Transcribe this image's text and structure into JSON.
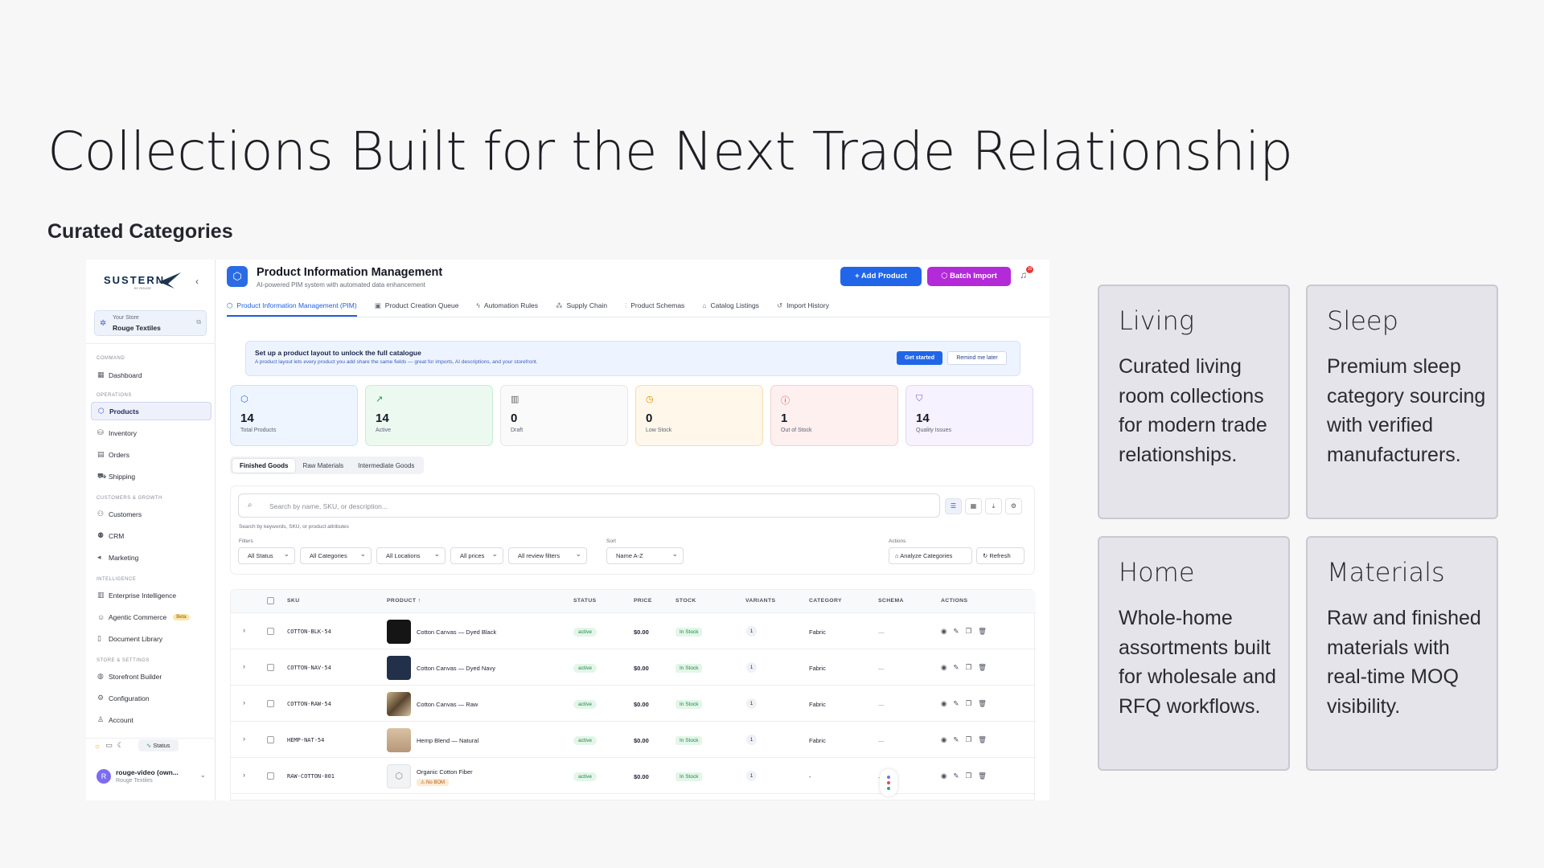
{
  "slide": {
    "title": "Collections Built for the Next Trade Relationship",
    "subtitle": "Curated Categories"
  },
  "sidebar": {
    "logo": "SUSTERN",
    "logo_tagline": "BY ROUGE",
    "store_label": "Your Store",
    "store_name": "Rouge Textiles",
    "sections": {
      "command": "COMMAND",
      "operations": "OPERATIONS",
      "customers": "CUSTOMERS & GROWTH",
      "intelligence": "INTELLIGENCE",
      "store": "STORE & SETTINGS"
    },
    "items": {
      "dashboard": "Dashboard",
      "products": "Products",
      "inventory": "Inventory",
      "orders": "Orders",
      "shipping": "Shipping",
      "customers": "Customers",
      "crm": "CRM",
      "marketing": "Marketing",
      "enterprise": "Enterprise Intelligence",
      "agentic": "Agentic Commerce",
      "agentic_badge": "Beta",
      "library": "Document Library",
      "storefront": "Storefront Builder",
      "configuration": "Configuration",
      "account": "Account"
    },
    "status_label": "Status",
    "user_name": "rouge-video (own...",
    "user_org": "Rouge Textiles",
    "user_initial": "R"
  },
  "header": {
    "title": "Product Information Management",
    "subtitle": "AI-powered PIM system with automated data enhancement",
    "add_label": "+ Add Product",
    "batch_label": "Batch Import",
    "notif_count": "10"
  },
  "tabs": [
    "Product Information Management (PIM)",
    "Product Creation Queue",
    "Automation Rules",
    "Supply Chain",
    "Product Schemas",
    "Catalog Listings",
    "Import History"
  ],
  "banner": {
    "title": "Set up a product layout to unlock the full catalogue",
    "body": "A product layout lets every product you add share the same fields — great for imports, AI descriptions, and your storefront.",
    "primary": "Get started",
    "secondary": "Remind me later"
  },
  "stats": [
    {
      "value": "14",
      "label": "Total Products"
    },
    {
      "value": "14",
      "label": "Active"
    },
    {
      "value": "0",
      "label": "Draft"
    },
    {
      "value": "0",
      "label": "Low Stock"
    },
    {
      "value": "1",
      "label": "Out of Stock"
    },
    {
      "value": "14",
      "label": "Quality Issues"
    }
  ],
  "segments": [
    "Finished Goods",
    "Raw Materials",
    "Intermediate Goods"
  ],
  "filters": {
    "search_placeholder": "Search by name, SKU, or description...",
    "hint": "Search by keywords, SKU, or product attributes",
    "filters_label": "Filters",
    "sort_label": "Sort",
    "actions_label": "Actions",
    "status": "All Status",
    "categories": "All Categories",
    "locations": "All Locations",
    "prices": "All prices",
    "reviews": "All review filters",
    "sort": "Name A-Z",
    "analyze": "Analyze Categories",
    "refresh": "Refresh"
  },
  "table": {
    "headers": [
      "SKU",
      "PRODUCT ↑",
      "STATUS",
      "PRICE",
      "STOCK",
      "VARIANTS",
      "CATEGORY",
      "SCHEMA",
      "ACTIONS"
    ],
    "rows": [
      {
        "sku": "COTTON-BLK-54",
        "product": "Cotton Canvas — Dyed Black",
        "status": "active",
        "price": "$0.00",
        "stock": "In Stock",
        "variants": "1",
        "category": "Fabric",
        "schema": "—"
      },
      {
        "sku": "COTTON-NAV-54",
        "product": "Cotton Canvas — Dyed Navy",
        "status": "active",
        "price": "$0.00",
        "stock": "In Stock",
        "variants": "1",
        "category": "Fabric",
        "schema": "—"
      },
      {
        "sku": "COTTON-RAW-54",
        "product": "Cotton Canvas — Raw",
        "status": "active",
        "price": "$0.00",
        "stock": "In Stock",
        "variants": "1",
        "category": "Fabric",
        "schema": "—"
      },
      {
        "sku": "HEMP-NAT-54",
        "product": "Hemp Blend — Natural",
        "status": "active",
        "price": "$0.00",
        "stock": "In Stock",
        "variants": "1",
        "category": "Fabric",
        "schema": "—"
      },
      {
        "sku": "RAW-COTTON-001",
        "product": "Organic Cotton Fiber",
        "tag": "No BOM",
        "status": "active",
        "price": "$0.00",
        "stock": "In Stock",
        "variants": "1",
        "category": "-",
        "schema": "—"
      }
    ]
  },
  "tiles": [
    {
      "title": "Living",
      "body": "Curated living room collections for modern trade relationships."
    },
    {
      "title": "Sleep",
      "body": "Premium sleep category sourcing with verified manufacturers."
    },
    {
      "title": "Home",
      "body": "Whole-home assortments built for wholesale and RFQ workflows."
    },
    {
      "title": "Materials",
      "body": "Raw and finished materials with real-time MOQ visibility."
    }
  ],
  "colors": {
    "primary": "#2166e8",
    "batch": "#b32ad8",
    "tile_bg": "#e4e4ea"
  }
}
